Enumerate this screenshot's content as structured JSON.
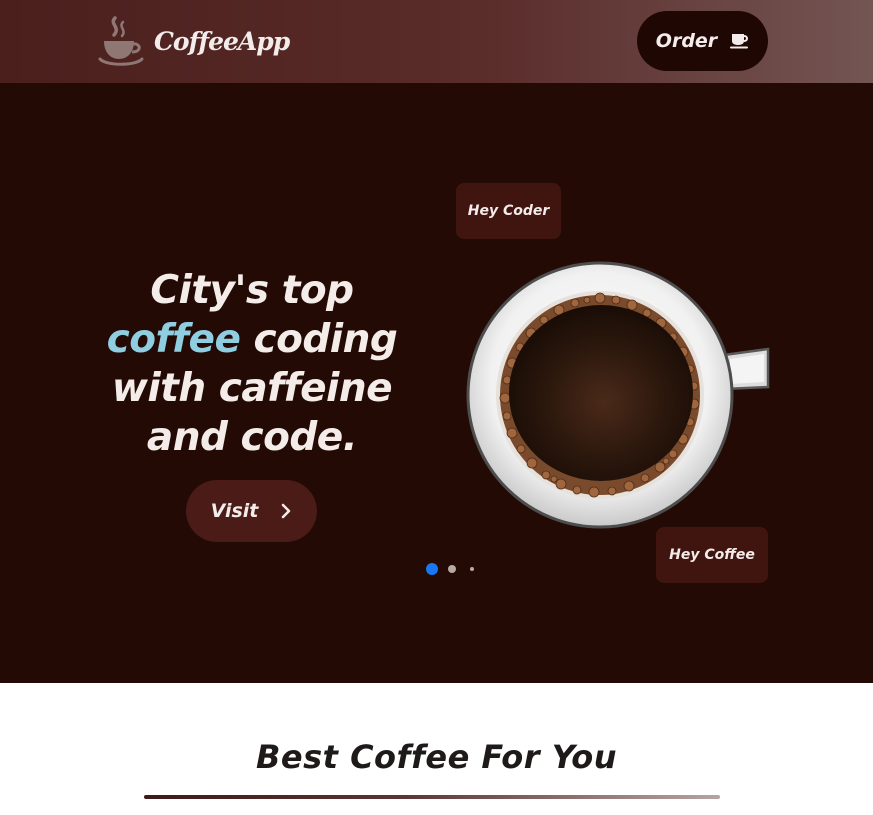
{
  "header": {
    "logo_text": "CoffeeApp",
    "logo_icon": "coffee-cup-steam-icon",
    "order_label": "Order",
    "order_icon": "coffee-cup-icon"
  },
  "hero": {
    "headline_start": "City's top",
    "headline_highlight": "coffee",
    "headline_rest_line2": " coding",
    "headline_line3": "with caffeine",
    "headline_line4": "and code.",
    "visit_label": "Visit",
    "visit_icon": "chevron-right-icon",
    "image": "coffee-cup-top-view",
    "bubble_top": "Hey Coder",
    "bubble_bottom": "Hey Coffee",
    "carousel": {
      "total": 3,
      "active": 1
    }
  },
  "section": {
    "title": "Best Coffee For You"
  },
  "colors": {
    "header_gradient_start": "#4a1f1c",
    "header_gradient_end": "#735553",
    "hero_bg": "#230a05",
    "button_bg": "#4a1b17",
    "order_bg": "#1f0704",
    "highlight": "#8fcde0",
    "active_dot": "#1877f2"
  }
}
